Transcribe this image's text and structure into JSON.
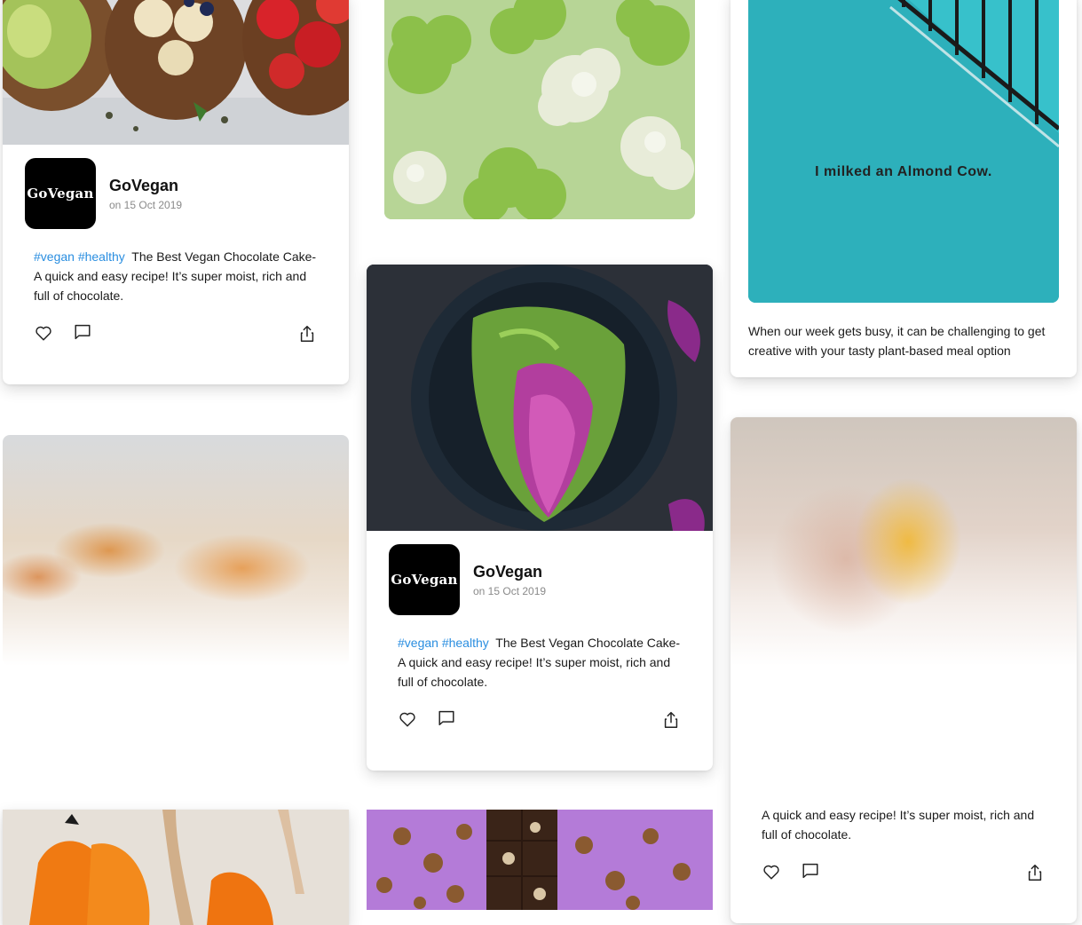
{
  "colors": {
    "hashtag": "#2a8ee0",
    "text": "#1a1a1a",
    "date": "#8a8a8a",
    "card_bg": "#ffffff"
  },
  "post1": {
    "author": "GoVegan",
    "avatar_text": "GoVegan",
    "date": "on 15 Oct 2019",
    "tag1": "#vegan",
    "tag2": "#healthy",
    "caption": "The Best Vegan Chocolate Cake- A quick and easy recipe! It’s super moist, rich and full of chocolate."
  },
  "post2": {
    "author": "GoVegan",
    "avatar_text": "GoVegan",
    "date": "on 15 Oct 2019",
    "tag1": "#vegan",
    "tag2": "#healthy",
    "caption": "The Best Vegan Chocolate Cake- A quick and easy recipe! It’s super moist, rich and full of chocolate."
  },
  "post3": {
    "image_text": "I milked an Almond Cow.",
    "caption": "When our week gets busy, it can be challenging to get creative with your tasty plant-based meal option"
  },
  "post4": {
    "caption": "A quick and easy recipe! It’s super moist, rich and full of chocolate."
  },
  "icons": {
    "like": "heart-icon",
    "comment": "comment-icon",
    "share": "share-icon"
  }
}
